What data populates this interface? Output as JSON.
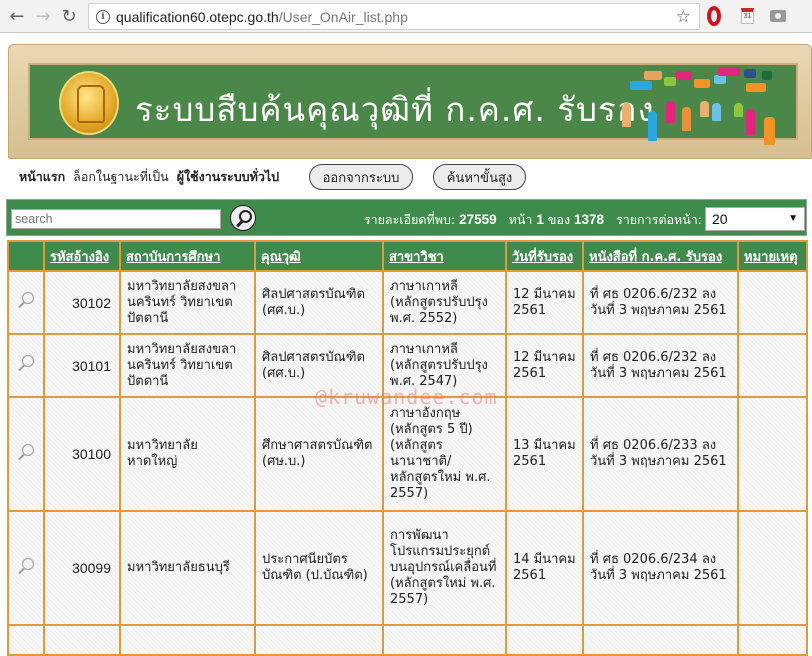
{
  "browser": {
    "url_host": "qualification60.otepc.go.th",
    "url_path": "/User_OnAir_list.php",
    "calendar_day": "31"
  },
  "banner": {
    "title": "ระบบสืบค้นคุณวุฒิที่ ก.ค.ศ. รับรอง"
  },
  "nav": {
    "home": "หน้าแรก",
    "login_as": "ล็อกในฐานะที่เป็น",
    "user_role": "ผู้ใช้งานระบบทั่วไป",
    "logout_label": "ออกจากระบบ",
    "advanced_search_label": "ค้นหาขั้นสูง"
  },
  "search": {
    "placeholder": "search",
    "value": ""
  },
  "stats": {
    "found_label": "รายละเอียดที่พบ:",
    "found_count": "27559",
    "page_label": "หน้า",
    "page_current": "1",
    "page_of": "ของ",
    "page_total": "1378",
    "per_page_label": "รายการต่อหน้า:",
    "per_page_value": "20"
  },
  "table": {
    "headers": [
      "รหัสอ้างอิง",
      "สถาบันการศึกษา",
      "คุณวุฒิ",
      "สาขาวิชา",
      "วันที่รับรอง",
      "หนังสือที่ ก.ค.ศ. รับรอง",
      "หมายเหตุ"
    ],
    "rows": [
      {
        "id": "30102",
        "institution": "มหาวิทยาลัยสงขลานครินทร์ วิทยาเขตปัตตานี",
        "qualification": "ศิลปศาสตรบัณฑิต (ศศ.บ.)",
        "major": "ภาษาเกาหลี (หลักสูตรปรับปรุง พ.ศ. 2552)",
        "date": "12 มีนาคม 2561",
        "letter": "ที่ ศธ 0206.6/232 ลง วันที่ 3 พฤษภาคม 2561",
        "note": ""
      },
      {
        "id": "30101",
        "institution": "มหาวิทยาลัยสงขลานครินทร์ วิทยาเขตปัตตานี",
        "qualification": "ศิลปศาสตรบัณฑิต (ศศ.บ.)",
        "major": "ภาษาเกาหลี (หลักสูตรปรับปรุง พ.ศ. 2547)",
        "date": "12 มีนาคม 2561",
        "letter": "ที่ ศธ 0206.6/232 ลง วันที่ 3 พฤษภาคม 2561",
        "note": ""
      },
      {
        "id": "30100",
        "institution": "มหาวิทยาลัยหาดใหญ่",
        "qualification": "ศึกษาศาสตรบัณฑิต (ศษ.บ.)",
        "major": "ภาษาอังกฤษ (หลักสูตร 5 ปี) (หลักสูตรนานาชาติ/หลักสูตรใหม่ พ.ศ. 2557)",
        "date": "13 มีนาคม 2561",
        "letter": "ที่ ศธ 0206.6/233 ลง วันที่ 3 พฤษภาคม 2561",
        "note": ""
      },
      {
        "id": "30099",
        "institution": "มหาวิทยาลัยธนบุรี",
        "qualification": "ประกาศนียบัตรบัณฑิต (ป.บัณฑิต)",
        "major": "การพัฒนาโปรแกรมประยุกต์บนอุปกรณ์เคลื่อนที่ (หลักสูตรใหม่ พ.ศ. 2557)",
        "date": "14 มีนาคม 2561",
        "letter": "ที่ ศธ 0206.6/234 ลง วันที่ 3 พฤษภาคม 2561",
        "note": ""
      }
    ]
  },
  "watermark": "@kruwandee.com",
  "colors": {
    "header_green": "#3f8b4c",
    "border_orange": "#e49a3a",
    "banner_green": "#4a8748"
  }
}
